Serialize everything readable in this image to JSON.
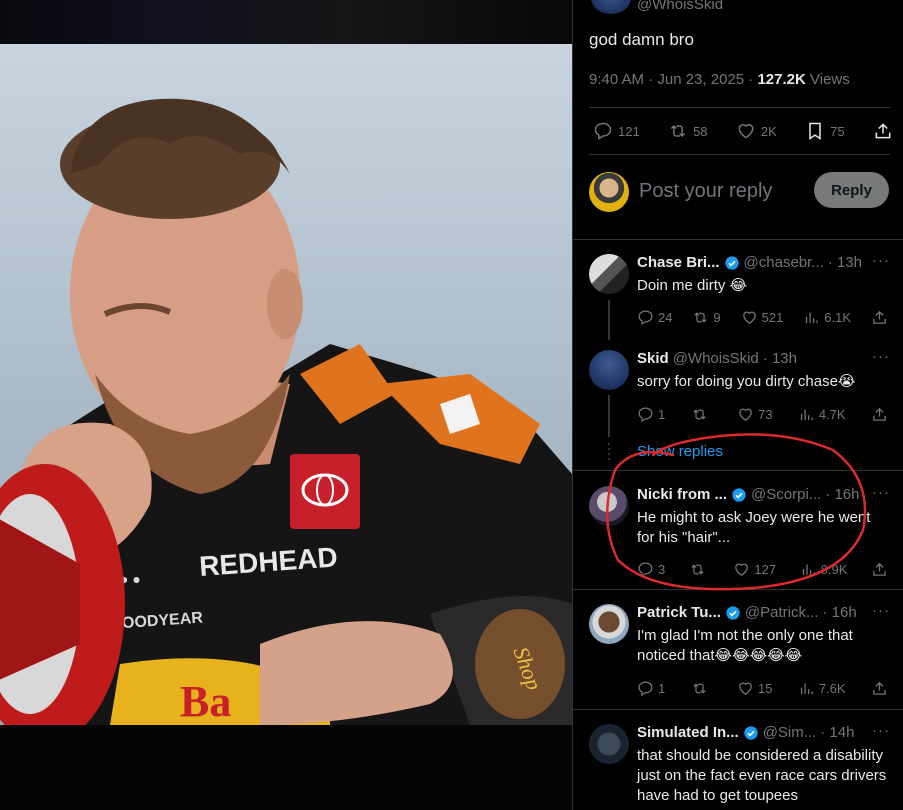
{
  "tweet": {
    "author_handle": "@WhoisSkid",
    "text": "god damn bro",
    "time": "9:40 AM · Jun 23, 2025 · ",
    "views_count": "127.2K",
    "views_label": " Views",
    "stats": {
      "replies": "121",
      "reposts": "58",
      "likes": "2K",
      "bookmarks": "75"
    }
  },
  "reply_box": {
    "placeholder": "Post your reply",
    "button": "Reply"
  },
  "comments": [
    {
      "name": "Chase Bri...",
      "handle": "@chasebr...",
      "time": "· 13h",
      "verified": true,
      "text": "Doin me dirty 😂",
      "replies": "24",
      "reposts": "9",
      "likes": "521",
      "views": "6.1K"
    },
    {
      "name": "Skid",
      "handle": "@WhoisSkid",
      "time": "· 13h",
      "verified": false,
      "text": "sorry for doing you dirty chase😭",
      "replies": "1",
      "reposts": "",
      "likes": "73",
      "views": "4.7K"
    },
    {
      "name": "Nicki from ...",
      "handle": "@Scorpi...",
      "time": "· 16h",
      "verified": true,
      "text": "He might to ask Joey were he went for his \"hair\"...",
      "replies": "3",
      "reposts": "",
      "likes": "127",
      "views": "8.9K"
    },
    {
      "name": "Patrick Tu...",
      "handle": "@Patrick...",
      "time": "· 16h",
      "verified": true,
      "text": "I'm glad I'm not the only one that noticed that😂😂😂😂😂",
      "replies": "1",
      "reposts": "",
      "likes": "15",
      "views": "7.6K"
    },
    {
      "name": "Simulated In...",
      "handle": "@Sim...",
      "time": "· 14h",
      "verified": true,
      "text": "that should be considered a disability just on the fact even race cars drivers have had to get toupees"
    }
  ],
  "show_replies": "Show replies",
  "more_label": "···",
  "colors": {
    "accent": "#1d9bf0",
    "annotation": "#d92b2b",
    "muted": "#71767b",
    "text": "#e7e9ea"
  },
  "icons": [
    "reply-icon",
    "repost-icon",
    "like-icon",
    "bookmark-icon",
    "share-icon",
    "views-icon",
    "verified-icon",
    "more-icon"
  ]
}
